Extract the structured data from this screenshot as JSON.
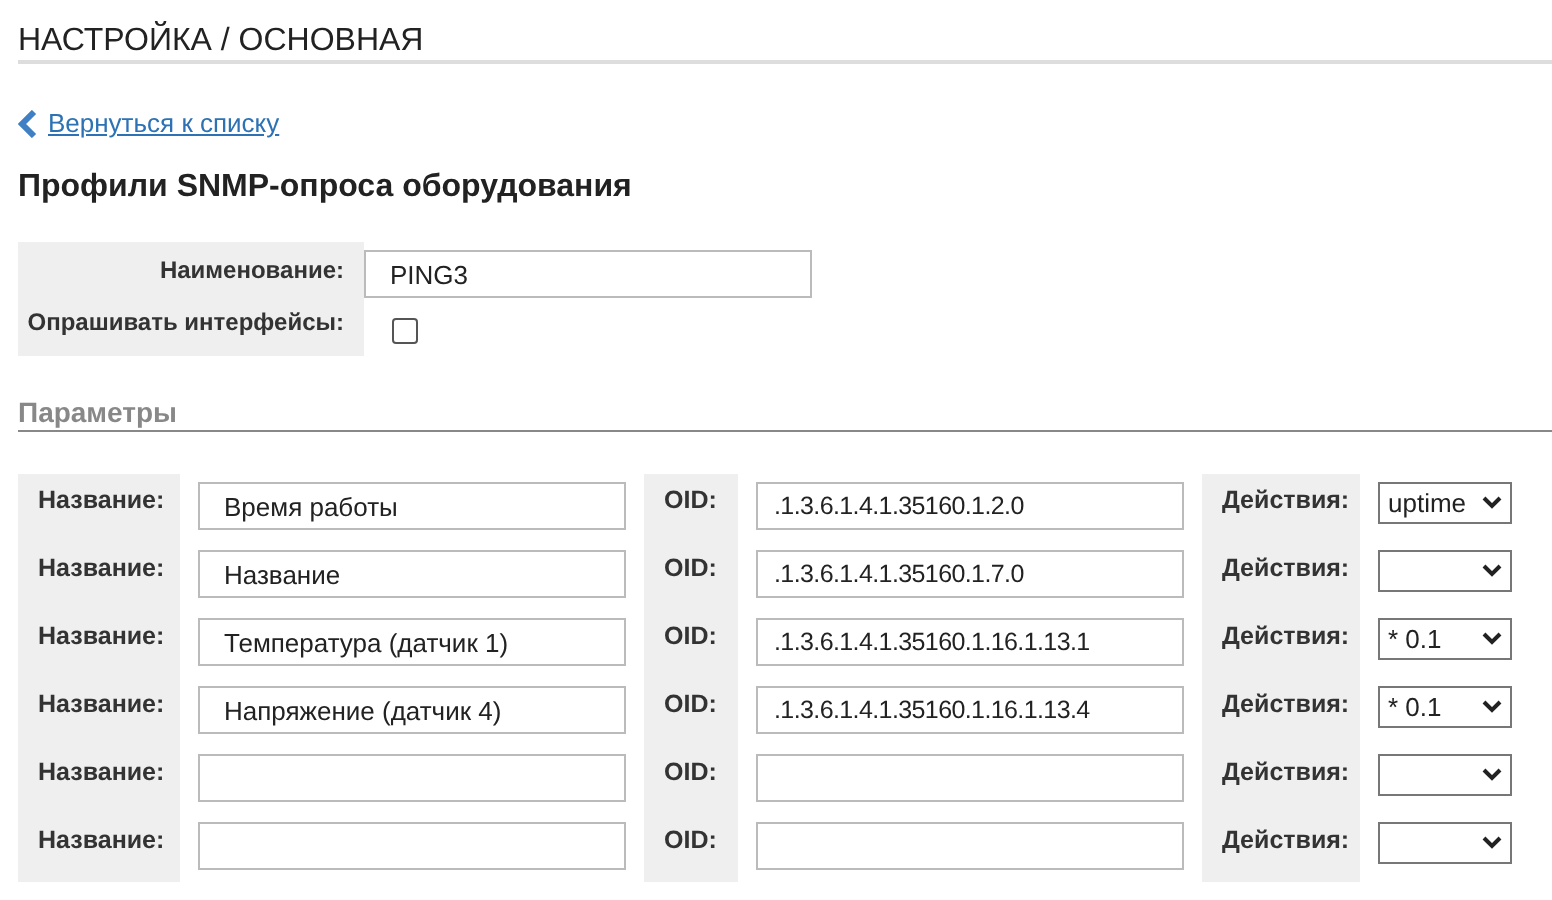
{
  "page_title": "НАСТРОЙКА / ОСНОВНАЯ",
  "back_link": {
    "label": "Вернуться к списку"
  },
  "heading": "Профили SNMP-опроса оборудования",
  "profile": {
    "name_label": "Наименование:",
    "name_value": "PING3",
    "poll_label": "Опрашивать интерфейсы:",
    "poll_checked": false
  },
  "section_title": "Параметры",
  "parameters": [
    {
      "name_label": "Название:",
      "name": "Время работы",
      "oid_label": "OID:",
      "oid": ".1.3.6.1.4.1.35160.1.2.0",
      "action_label": "Действия:",
      "action": "uptime"
    },
    {
      "name_label": "Название:",
      "name": "Название",
      "oid_label": "OID:",
      "oid": ".1.3.6.1.4.1.35160.1.7.0",
      "action_label": "Действия:"
    },
    {
      "name_label": "Название:",
      "name": "Температура (датчик 1)",
      "oid_label": "OID:",
      "oid": ".1.3.6.1.4.1.35160.1.16.1.13.1",
      "action_label": "Действия:",
      "action": "* 0.1"
    },
    {
      "name_label": "Название:",
      "name": "Напряжение (датчик 4)",
      "oid_label": "OID:",
      "oid": ".1.3.6.1.4.1.35160.1.16.1.13.4",
      "action_label": "Действия:",
      "action": "* 0.1"
    },
    {
      "name_label": "Название:",
      "oid_label": "OID:",
      "action_label": "Действия:"
    },
    {
      "name_label": "Название:",
      "oid_label": "OID:",
      "action_label": "Действия:"
    }
  ]
}
